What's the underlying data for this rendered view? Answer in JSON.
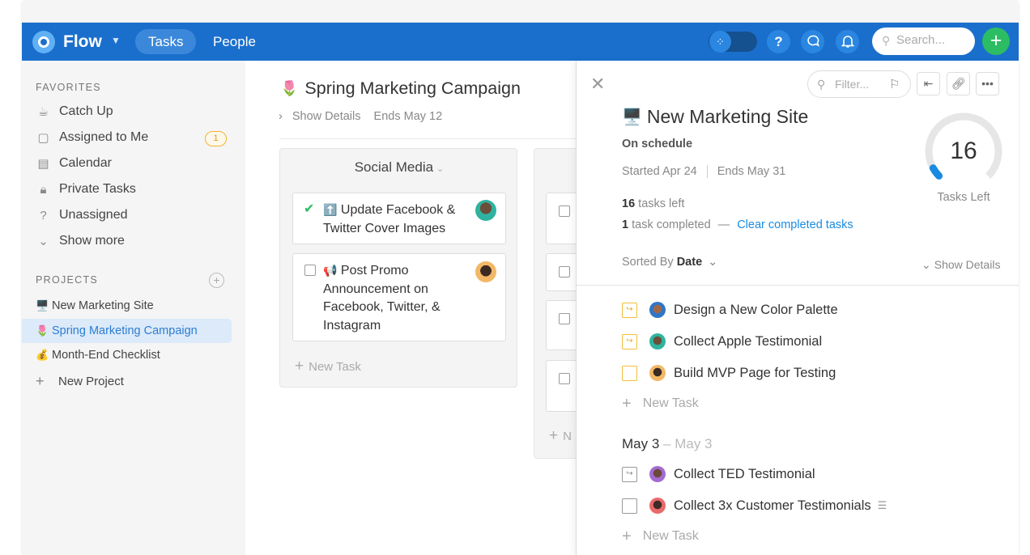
{
  "app": {
    "brand": "Flow",
    "nav_tabs": [
      "Tasks",
      "People"
    ],
    "search_placeholder": "Search...",
    "colors": {
      "topbar": "#1a6fcd",
      "accent_green": "#2cbc63",
      "link": "#1a8be0",
      "badge": "#f0b431"
    }
  },
  "sidebar": {
    "favorites_title": "FAVORITES",
    "favorites": [
      {
        "label": "Catch Up",
        "icon": "cup-icon"
      },
      {
        "label": "Assigned to Me",
        "icon": "clipboard-icon",
        "badge": "1"
      },
      {
        "label": "Calendar",
        "icon": "calendar-icon"
      },
      {
        "label": "Private Tasks",
        "icon": "lock-icon"
      },
      {
        "label": "Unassigned",
        "icon": "question-icon"
      },
      {
        "label": "Show more",
        "icon": "chevron-down-icon"
      }
    ],
    "projects_title": "PROJECTS",
    "projects": [
      {
        "label": "New Marketing Site",
        "emoji": "🖥️"
      },
      {
        "label": "Spring Marketing Campaign",
        "emoji": "🌷",
        "active": true
      },
      {
        "label": "Month-End Checklist",
        "emoji": "💰"
      }
    ],
    "new_project": "New Project"
  },
  "board": {
    "title": "Spring Marketing Campaign",
    "show_details": "Show Details",
    "ends": "Ends May 12",
    "column": {
      "title": "Social Media",
      "cards": [
        {
          "text": "Update Facebook & Twitter Cover Images",
          "emoji": "⬆️",
          "done": true
        },
        {
          "text": "Post Promo Announcement on Facebook, Twitter, & Instagram",
          "emoji": "📢",
          "done": false
        }
      ],
      "new_task": "New Task"
    },
    "column2_new": "N"
  },
  "panel": {
    "title": "New Marketing Site",
    "status": "On schedule",
    "started": "Started Apr 24",
    "ends": "Ends May 31",
    "tasks_left_count": "16",
    "tasks_left_text": "tasks left",
    "completed_count": "1",
    "completed_text": "task completed",
    "dash": "—",
    "clear_link": "Clear completed tasks",
    "gauge_value": "16",
    "gauge_label": "Tasks Left",
    "gauge_fraction": 0.06,
    "filter_placeholder": "Filter...",
    "sorted_by": "Sorted By",
    "sort_field": "Date",
    "show_details": "Show Details",
    "tasks_group1": [
      {
        "text": "Design a New Color Palette",
        "box": "yellow-arrow"
      },
      {
        "text": "Collect Apple Testimonial",
        "box": "yellow-arrow"
      },
      {
        "text": "Build MVP Page for Testing",
        "box": "yellow"
      }
    ],
    "new_task": "New Task",
    "date_group": {
      "start": "May 3",
      "end": "– May 3"
    },
    "tasks_group2": [
      {
        "text": "Collect TED Testimonial",
        "box": "gray-arrow"
      },
      {
        "text": "Collect 3x Customer Testimonials",
        "box": "gray",
        "notes": true
      }
    ]
  }
}
